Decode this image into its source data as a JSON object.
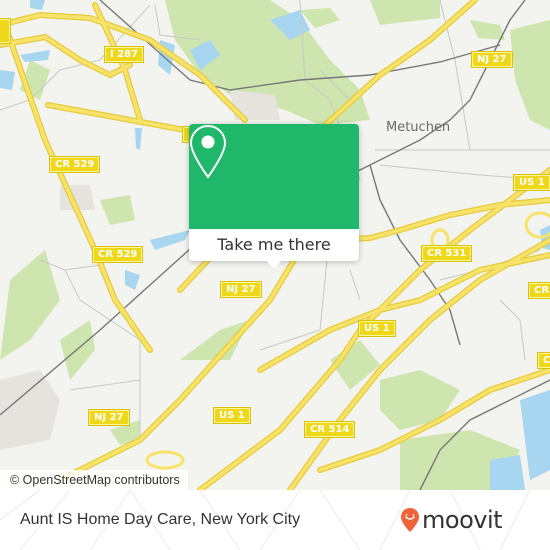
{
  "map": {
    "place_labels": [
      {
        "name": "Metuchen"
      }
    ],
    "road_shields": [
      {
        "label": "I 287"
      },
      {
        "label": "NJ 27"
      },
      {
        "label": "CR 529"
      },
      {
        "label": "CR 529"
      },
      {
        "label": "US 1"
      },
      {
        "label": "NJ 27"
      },
      {
        "label": "CR 531"
      },
      {
        "label": "US 1"
      },
      {
        "label": "NJ 27"
      },
      {
        "label": "US 1"
      },
      {
        "label": "CR 514"
      },
      {
        "label": "CR"
      },
      {
        "label": "C"
      }
    ],
    "attribution": "© OpenStreetMap contributors",
    "colors": {
      "land": "#f3f3ef",
      "park": "#cfe5b0",
      "water": "#a8d5ef",
      "road_major": "#f5dd55",
      "road_minor": "#c8c8c4",
      "rail": "#777777",
      "shield": "#efd81a"
    }
  },
  "popup": {
    "icon": "location-pin-icon",
    "button_label": "Take me there",
    "accent_color": "#1fb86a"
  },
  "footer": {
    "title": "Aunt IS Home Day Care, New York City",
    "brand": "moovit",
    "brand_icon": "moovit-pin-logo-icon",
    "brand_color": "#f0623a"
  }
}
